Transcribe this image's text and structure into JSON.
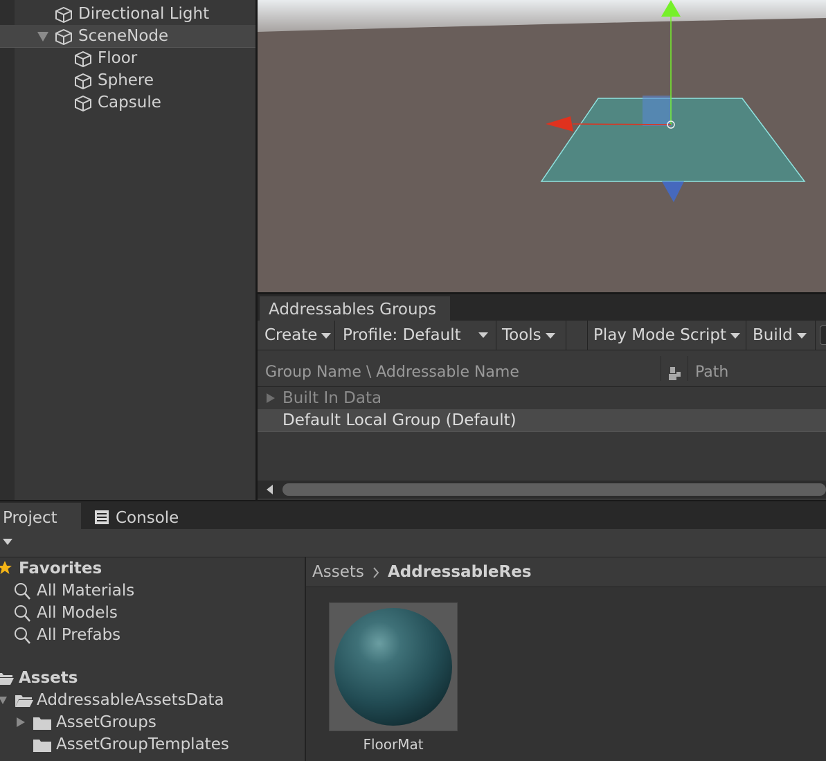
{
  "hierarchy": {
    "items": [
      {
        "label": "Directional Light"
      },
      {
        "label": "SceneNode"
      },
      {
        "label": "Floor"
      },
      {
        "label": "Sphere"
      },
      {
        "label": "Capsule"
      }
    ]
  },
  "addressables": {
    "tab_title": "Addressables Groups",
    "toolbar": {
      "create": "Create",
      "profile": "Profile: Default",
      "tools": "Tools",
      "play_mode_script": "Play Mode Script",
      "build": "Build"
    },
    "columns": {
      "name": "Group Name \\ Addressable Name",
      "path": "Path"
    },
    "rows": [
      {
        "label": "Built In Data"
      },
      {
        "label": "Default Local Group (Default)"
      }
    ]
  },
  "project": {
    "tabs": {
      "project": "Project",
      "console": "Console"
    },
    "favorites": {
      "title": "Favorites",
      "items": [
        "All Materials",
        "All Models",
        "All Prefabs"
      ]
    },
    "assets": {
      "title": "Assets",
      "items": [
        "AddressableAssetsData",
        "AssetGroups",
        "AssetGroupTemplates"
      ]
    },
    "breadcrumb": {
      "root": "Assets",
      "current": "AddressableRes"
    },
    "asset_items": [
      {
        "label": "FloorMat"
      }
    ]
  },
  "colors": {
    "panel": "#383838",
    "scene_ground": "#695e5a",
    "plane_fill": "#4f8b86",
    "gizmo_red": "#e0321e",
    "gizmo_green": "#76f02a",
    "gizmo_blue": "#3d6bd6",
    "favorite_star": "#f5b517"
  }
}
